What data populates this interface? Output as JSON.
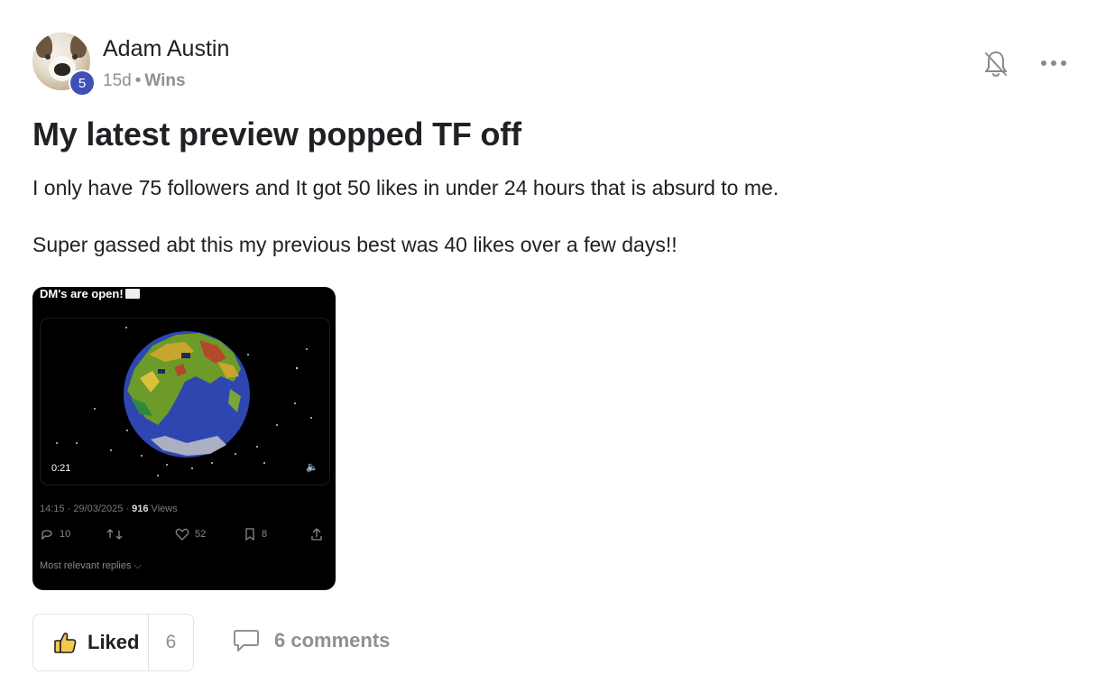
{
  "post": {
    "author": "Adam Austin",
    "level": "5",
    "age": "15d",
    "separator": "•",
    "category": "Wins",
    "title": "My latest preview popped TF off",
    "paragraphs": [
      "I only have 75 followers and It got 50 likes in under 24 hours that is absurd to me.",
      "Super gassed abt this my previous best was 40 likes over a few days!!"
    ]
  },
  "embedded_screenshot": {
    "caption": "DM's are open!",
    "video_duration": "0:21",
    "timestamp": "14:15 · 29/03/2025 · ",
    "views_count": "916",
    "views_label": " Views",
    "replies_count": "10",
    "likes_count": "52",
    "bookmarks_count": "8",
    "sort_label": "Most relevant replies"
  },
  "footer": {
    "like_label": "Liked",
    "like_count": "6",
    "comments_label": "6 comments"
  },
  "icons": {
    "notification": "bell-off-icon",
    "menu": "more-horizontal-icon",
    "like": "thumbs-up-icon",
    "comment": "comment-bubble-icon"
  },
  "colors": {
    "level_badge": "#3f51b5",
    "like_thumb": "#f2c94c",
    "muted_text": "#909090"
  }
}
